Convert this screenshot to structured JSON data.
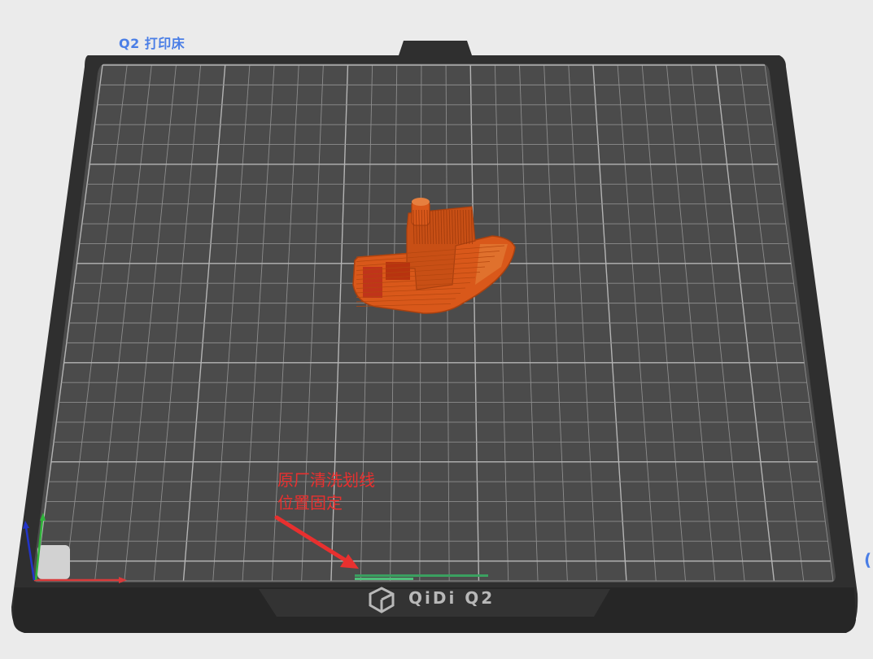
{
  "plate": {
    "label": "Q2 打印床"
  },
  "annotation": {
    "line1": "原厂清洗划线",
    "line2": "位置固定"
  },
  "brand": {
    "name": "QiDi  Q2"
  },
  "edge_glyph": "(",
  "colors": {
    "background": "#ebebeb",
    "bed_frame": "#2f2f2f",
    "bed_surface": "#4b4b4b",
    "grid": "#9a9a9a",
    "model": "#d9581a",
    "label_accent": "#4a7ee6",
    "annotation": "#e8302f",
    "purge_line": "#3aa060",
    "axis_x": "#d93a3a",
    "axis_y": "#2fb43a",
    "axis_z": "#2234c8"
  },
  "icons": [
    "qidi-logo-icon",
    "axis-gizmo-icon",
    "arrow-icon"
  ]
}
